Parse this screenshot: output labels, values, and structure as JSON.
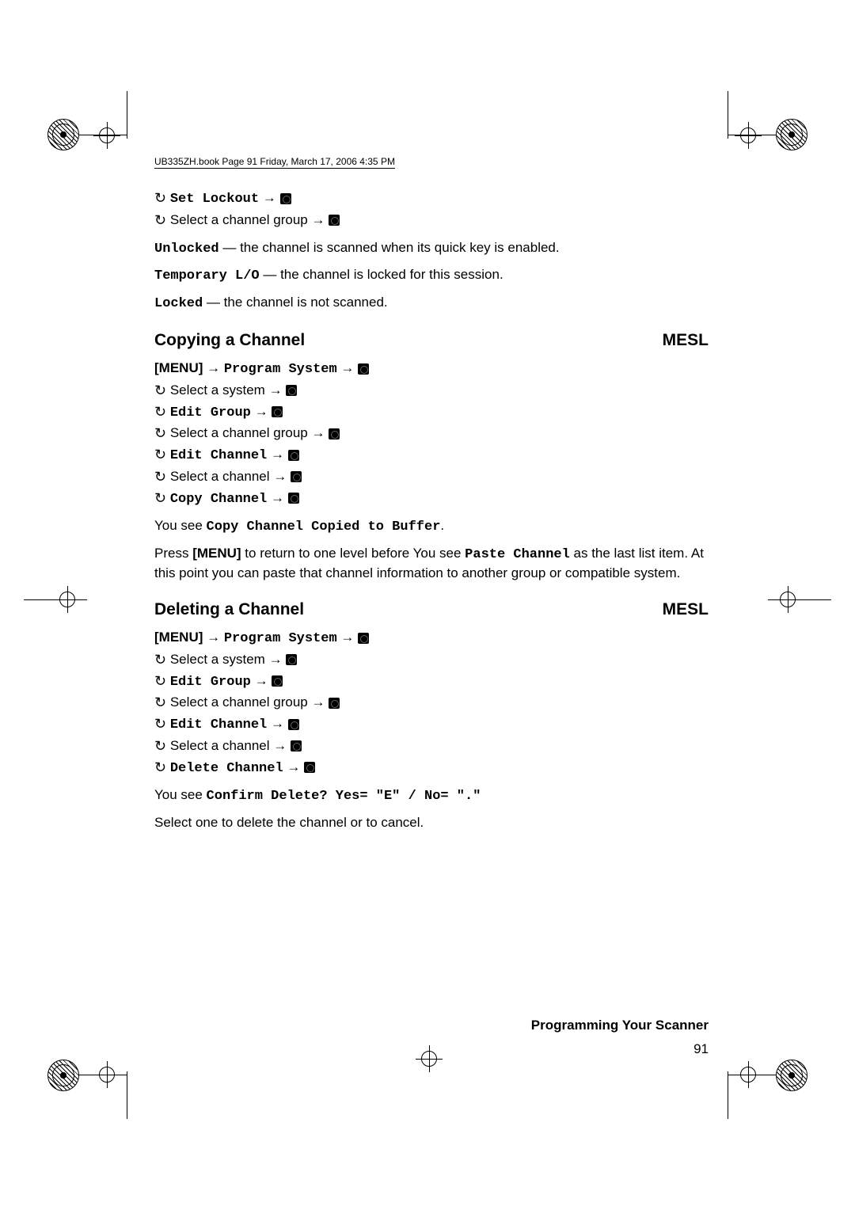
{
  "header_line": "UB335ZH.book  Page 91  Friday, March 17, 2006  4:35 PM",
  "intro_steps": [
    {
      "code": "Set Lockout",
      "prefix_icon": "rotate-icon",
      "arrow": true,
      "disc": true
    },
    {
      "text": "Select a channel group",
      "prefix_icon": "rotate-icon",
      "arrow": true,
      "disc": true
    }
  ],
  "defs": [
    {
      "term": "Unlocked",
      "desc": " — the channel is scanned when its quick key is enabled."
    },
    {
      "term": "Temporary L/O",
      "desc": " — the channel is locked for this session."
    },
    {
      "term": "Locked",
      "desc": " — the channel is not scanned."
    }
  ],
  "section1": {
    "title": "Copying a Channel",
    "tag": "MESL",
    "menu_label": "[MENU]",
    "menu_code": "Program System",
    "steps": [
      {
        "text": "Select a system"
      },
      {
        "code": "Edit Group"
      },
      {
        "text": "Select a channel group"
      },
      {
        "code": "Edit Channel"
      },
      {
        "text": "Select a channel"
      },
      {
        "code": "Copy Channel"
      }
    ],
    "result_pre": "You see ",
    "result_code": "Copy Channel Copied to Buffer",
    "result_post": ".",
    "para_pre": "Press ",
    "para_bold": "[MENU]",
    "para_mid": " to return to one level before You see ",
    "para_code": "Paste Channel",
    "para_end": " as the last list item. At this point you can paste that channel information to another group or compatible system."
  },
  "section2": {
    "title": "Deleting a Channel",
    "tag": "MESL",
    "menu_label": "[MENU]",
    "menu_code": "Program System",
    "steps": [
      {
        "text": "Select a system"
      },
      {
        "code": "Edit Group"
      },
      {
        "text": "Select a channel group"
      },
      {
        "code": "Edit Channel"
      },
      {
        "text": "Select a channel"
      },
      {
        "code": "Delete Channel"
      }
    ],
    "result_pre": "You see ",
    "result_code": "Confirm Delete? Yes= \"E\" / No= \".\"",
    "para": "Select one to delete the channel or to cancel."
  },
  "footer_title": "Programming Your Scanner",
  "footer_page": "91"
}
